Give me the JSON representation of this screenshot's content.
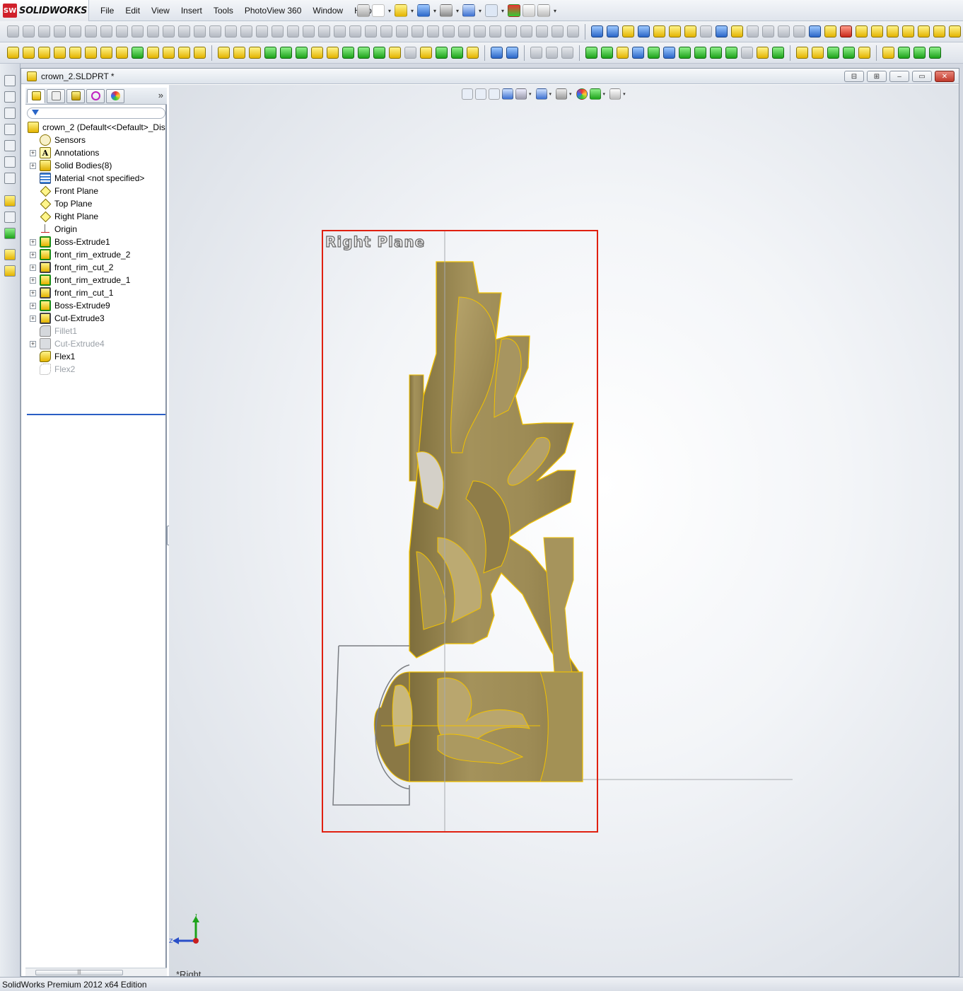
{
  "app": {
    "brand": "SOLIDWORKS",
    "brand_mark": "SW"
  },
  "menu": {
    "items": [
      "File",
      "Edit",
      "View",
      "Insert",
      "Tools",
      "PhotoView 360",
      "Window",
      "Help"
    ]
  },
  "document": {
    "title": "crown_2.SLDPRT *"
  },
  "window_buttons": {
    "tile_h": "⊟",
    "tile_v": "⊞",
    "minimize": "‒",
    "restore": "▭",
    "close": "✕"
  },
  "feature_manager": {
    "expand_glyph": "»",
    "root_label": "crown_2  (Default<<Default>_Dis",
    "items": [
      {
        "label": "Sensors",
        "icon": "sensor-icon",
        "expandable": false,
        "suppressed": false
      },
      {
        "label": "Annotations",
        "icon": "annotations-icon",
        "glyph": "A",
        "expandable": true,
        "suppressed": false
      },
      {
        "label": "Solid Bodies(8)",
        "icon": "solid-bodies-icon",
        "expandable": true,
        "suppressed": false
      },
      {
        "label": "Material <not specified>",
        "icon": "material-icon",
        "expandable": false,
        "suppressed": false
      },
      {
        "label": "Front Plane",
        "icon": "plane-icon",
        "expandable": false,
        "suppressed": false
      },
      {
        "label": "Top Plane",
        "icon": "plane-icon",
        "expandable": false,
        "suppressed": false
      },
      {
        "label": "Right Plane",
        "icon": "plane-icon",
        "expandable": false,
        "suppressed": false
      },
      {
        "label": "Origin",
        "icon": "origin-icon",
        "expandable": false,
        "suppressed": false
      },
      {
        "label": "Boss-Extrude1",
        "icon": "boss-extrude-icon",
        "expandable": true,
        "suppressed": false
      },
      {
        "label": "front_rim_extrude_2",
        "icon": "boss-extrude-icon",
        "expandable": true,
        "suppressed": false
      },
      {
        "label": "front_rim_cut_2",
        "icon": "cut-extrude-icon",
        "expandable": true,
        "suppressed": false
      },
      {
        "label": "front_rim_extrude_1",
        "icon": "boss-extrude-icon",
        "expandable": true,
        "suppressed": false
      },
      {
        "label": "front_rim_cut_1",
        "icon": "cut-extrude-icon",
        "expandable": true,
        "suppressed": false
      },
      {
        "label": "Boss-Extrude9",
        "icon": "boss-extrude-icon",
        "expandable": true,
        "suppressed": false
      },
      {
        "label": "Cut-Extrude3",
        "icon": "cut-extrude-icon",
        "expandable": true,
        "suppressed": false
      },
      {
        "label": "Fillet1",
        "icon": "fillet-icon",
        "expandable": false,
        "suppressed": true
      },
      {
        "label": "Cut-Extrude4",
        "icon": "cut-extrude-icon",
        "expandable": true,
        "suppressed": true
      },
      {
        "label": "Flex1",
        "icon": "flex-icon",
        "expandable": false,
        "suppressed": false
      },
      {
        "label": "Flex2",
        "icon": "flex-icon",
        "expandable": false,
        "suppressed": true
      }
    ]
  },
  "viewport": {
    "plane_label": "Right Plane",
    "view_name": "*Right",
    "triad": {
      "y_label": "Y",
      "z_label": "Z"
    }
  },
  "colors": {
    "part_face": "#9e8c55",
    "part_edge": "#f2c200",
    "selection_box": "#e02010"
  },
  "status": {
    "text": "SolidWorks Premium 2012 x64 Edition"
  }
}
